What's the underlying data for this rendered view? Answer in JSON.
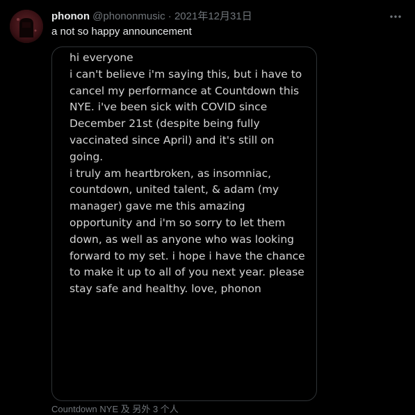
{
  "tweet": {
    "display_name": "phonon",
    "handle": "@phononmusic",
    "separator": "·",
    "timestamp": "2021年12月31日",
    "text": "a not so happy announcement",
    "more_icon": "more-horizontal-icon",
    "media": {
      "note_text": "hi everyone\ni can't believe i'm saying this, but i have to\ncancel my performance at Countdown this\nNYE.  i've been sick with COVID since\nDecember 21st (despite being fully\nvaccinated since April) and it's still on going.\ni truly am heartbroken, as insomniac,\ncountdown, united talent, & adam (my\nmanager) gave me this amazing\nopportunity and i'm so sorry to let them\ndown, as well as anyone who was looking\nforward to my set.  i hope i have the chance\nto make it up to all of you next year.  please\nstay safe and healthy.  love, phonon"
    },
    "tags": "Countdown NYE 及 另外 3 个人"
  },
  "colors": {
    "background": "#000000",
    "primary_text": "#e7e9ea",
    "secondary_text": "#71767b",
    "border": "#2f3336"
  }
}
